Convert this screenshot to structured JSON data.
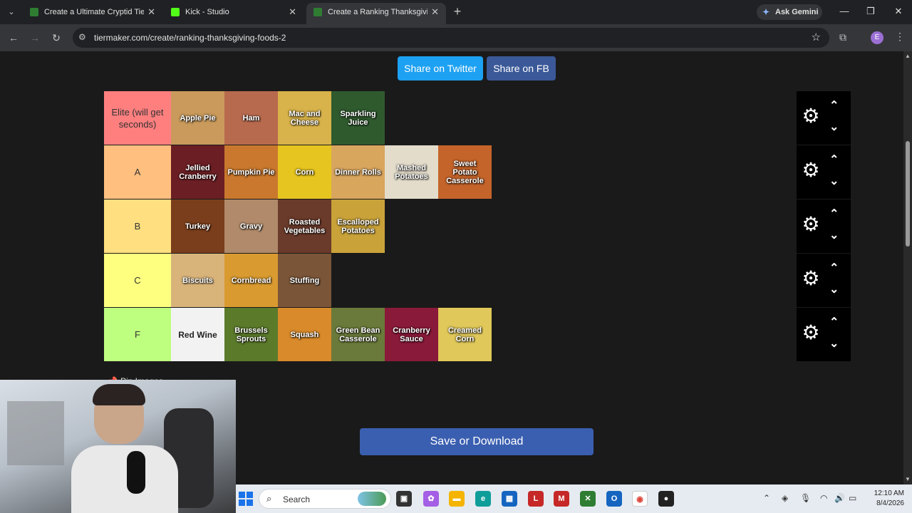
{
  "browser": {
    "tabs": [
      {
        "title": "Create a Ultimate Cryptid Tierlist",
        "favicon_color": "#2e7d32",
        "active": false
      },
      {
        "title": "Kick - Studio",
        "favicon_color": "#53fc18",
        "active": false
      },
      {
        "title": "Create a Ranking Thanksgiving Foods",
        "favicon_color": "#2e7d32",
        "active": true
      }
    ],
    "gemini_label": "Ask Gemini",
    "url": "tiermaker.com/create/ranking-thanksgiving-foods-2",
    "profile_initial": "E"
  },
  "share": {
    "twitter_label": "Share on Twitter",
    "fb_label": "Share on FB"
  },
  "tiers": [
    {
      "label": "Elite (will get seconds)",
      "color": "#ff7f7f",
      "items": [
        {
          "text": "Apple Pie",
          "color": "#c99a5b"
        },
        {
          "text": "Ham",
          "color": "#b86a4e"
        },
        {
          "text": "Mac and Cheese",
          "color": "#d8b24a"
        },
        {
          "text": "Sparkling Juice",
          "color": "#2f5a2e"
        }
      ]
    },
    {
      "label": "A",
      "color": "#ffbf7f",
      "items": [
        {
          "text": "Jellied Cranberry",
          "color": "#6b1f24"
        },
        {
          "text": "Pumpkin Pie",
          "color": "#c9782d"
        },
        {
          "text": "Corn",
          "color": "#e6c520"
        },
        {
          "text": "Dinner Rolls",
          "color": "#d9a65e"
        },
        {
          "text": "Mashed Potatoes",
          "color": "#e3dccb"
        },
        {
          "text": "Sweet Potato Casserole",
          "color": "#c4642a"
        }
      ]
    },
    {
      "label": "B",
      "color": "#ffdf7f",
      "items": [
        {
          "text": "Turkey",
          "color": "#7a3e1c"
        },
        {
          "text": "Gravy",
          "color": "#b08a6a"
        },
        {
          "text": "Roasted Vegetables",
          "color": "#6a3a2a"
        },
        {
          "text": "Escalloped Potatoes",
          "color": "#c9a23a"
        }
      ]
    },
    {
      "label": "C",
      "color": "#ffff7f",
      "items": [
        {
          "text": "Biscuits",
          "color": "#d8b47a"
        },
        {
          "text": "Cornbread",
          "color": "#d99a30"
        },
        {
          "text": "Stuffing",
          "color": "#7a5538"
        }
      ]
    },
    {
      "label": "F",
      "color": "#bfff7f",
      "items": [
        {
          "text": "Red Wine",
          "color": "#f2f2f2"
        },
        {
          "text": "Brussels Sprouts",
          "color": "#5b7a2a"
        },
        {
          "text": "Squash",
          "color": "#d98a2a"
        },
        {
          "text": "Green Bean Casserole",
          "color": "#6a7a3a"
        },
        {
          "text": "Cranberry Sauce",
          "color": "#8a1a3a"
        },
        {
          "text": "Creamed Corn",
          "color": "#e0c85a"
        }
      ]
    }
  ],
  "pin_label": "Pin Images",
  "save_label": "Save or Download",
  "taskbar": {
    "search_placeholder": "Search",
    "time": "12:10 AM",
    "date": "8/4/2026"
  }
}
